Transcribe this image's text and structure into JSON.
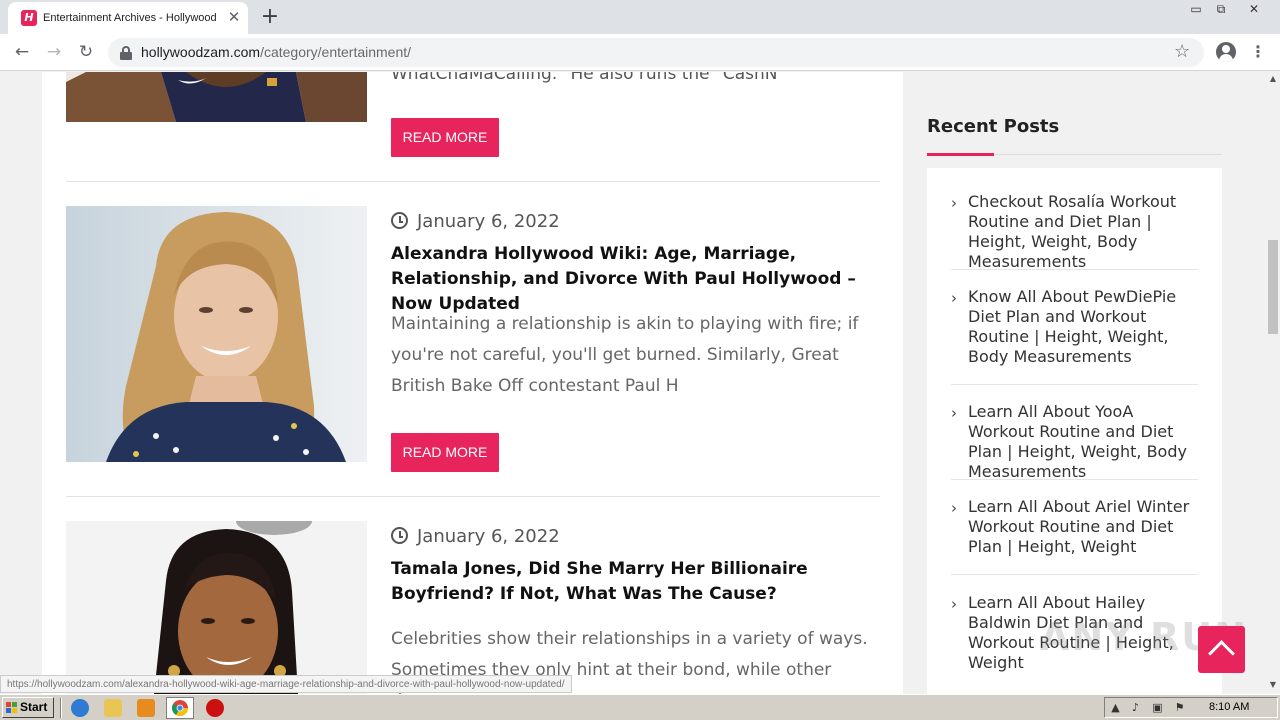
{
  "browser": {
    "tab_title": "Entertainment Archives - Hollywood",
    "tab_favicon_letter": "H",
    "close_glyph": "✕",
    "new_tab_glyph": "+",
    "back_glyph": "←",
    "forward_glyph": "→",
    "reload_glyph": "↻",
    "star_glyph": "☆",
    "menu_glyph": "⋮",
    "url_host": "hollywoodzam.com",
    "url_path": "/category/entertainment/",
    "window_controls": [
      "▭",
      "⧉",
      "✕"
    ]
  },
  "posts": [
    {
      "excerpt": "WhatChaMaCalling.\" He also runs the \"CashN",
      "read_more": "READ MORE"
    },
    {
      "date": "January 6, 2022",
      "title": "Alexandra Hollywood Wiki: Age, Marriage, Relationship, and Divorce With Paul Hollywood – Now Updated",
      "excerpt": "Maintaining a relationship is akin to playing with fire; if you're not careful, you'll get burned. Similarly, Great British Bake Off contestant Paul H",
      "read_more": "READ MORE"
    },
    {
      "date": "January 6, 2022",
      "title": "Tamala Jones, Did She Marry Her Billionaire Boyfriend? If Not, What Was The Cause?",
      "excerpt": "Celebrities show their relationships in a variety of ways. Sometimes they only hint at their bond, while other times"
    }
  ],
  "sidebar": {
    "heading": "Recent Posts",
    "chevron": "›",
    "items": [
      "Checkout Rosalía Workout Routine and Diet Plan | Height, Weight, Body Measurements",
      "Know All About PewDiePie Diet Plan and Workout Routine | Height, Weight, Body Measurements",
      "Learn All About YooA Workout Routine and Diet Plan | Height, Weight, Body Measurements",
      "Learn All About Ariel Winter Workout Routine and Diet Plan | Height, Weight",
      "Learn All About Hailey Baldwin Diet Plan and Workout Routine | Height, Weight"
    ]
  },
  "watermark": "ANY RUN",
  "status_bar_url": "https://hollywoodzam.com/alexandra-hollywood-wiki-age-marriage-relationship-and-divorce-with-paul-hollywood-now-updated/",
  "taskbar": {
    "start_label": "Start",
    "clock": "8:10 AM"
  },
  "colors": {
    "accent": "#e8245c",
    "taskbar": "#d4d0c8"
  }
}
